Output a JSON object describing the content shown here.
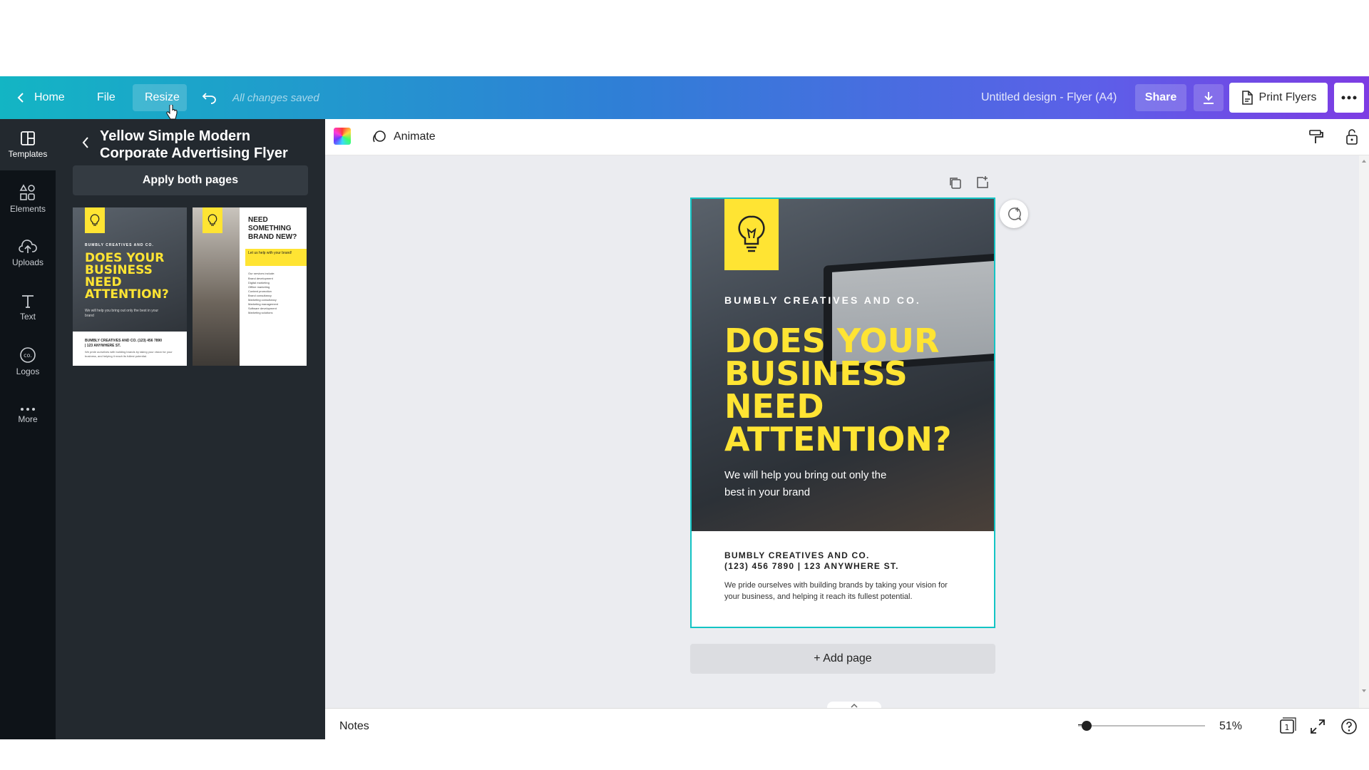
{
  "topbar": {
    "home_label": "Home",
    "file_label": "File",
    "resize_label": "Resize",
    "saved_status": "All changes saved",
    "design_title": "Untitled design - Flyer (A4)",
    "share_label": "Share",
    "print_label": "Print Flyers"
  },
  "rail": {
    "items": [
      {
        "label": "Templates",
        "icon": "templates-icon"
      },
      {
        "label": "Elements",
        "icon": "elements-icon"
      },
      {
        "label": "Uploads",
        "icon": "uploads-icon"
      },
      {
        "label": "Text",
        "icon": "text-icon"
      },
      {
        "label": "Logos",
        "icon": "logos-icon"
      },
      {
        "label": "More",
        "icon": "more-icon"
      }
    ]
  },
  "panel": {
    "title": "Yellow Simple Modern Corporate Advertising Flyer",
    "apply_label": "Apply both pages",
    "thumb1": {
      "company": "BUMBLY CREATIVES AND CO.",
      "headline": "DOES YOUR BUSINESS NEED ATTENTION?",
      "sub": "We will help you bring out only the best in your brand",
      "contact": "BUMBLY CREATIVES AND CO. (123) 456 7890 | 123 ANYWHERE ST.",
      "desc": "We pride ourselves with building brands by taking your vision for your business, and helping it reach its fullest potential."
    },
    "thumb2": {
      "headline": "NEED SOMETHING BRAND NEW?",
      "banner": "Let us help with your brand!",
      "intro": "Our services include:",
      "services": [
        "Brand development",
        "Digital marketing",
        "Offline marketing",
        "Content promotion",
        "Brand consultancy",
        "Marketing consultancy",
        "Marketing management",
        "Software development",
        "Marketing solutions"
      ]
    }
  },
  "toolbar": {
    "animate_label": "Animate"
  },
  "flyer": {
    "company": "BUMBLY CREATIVES AND CO.",
    "headline_lines": [
      "DOES YOUR",
      "BUSINESS",
      "NEED",
      "ATTENTION?"
    ],
    "sub_lines": [
      "We will help you bring out only the",
      "best in your brand"
    ],
    "contact_line1": "BUMBLY CREATIVES AND CO.",
    "contact_line2": "(123) 456 7890 | 123 ANYWHERE ST.",
    "desc_lines": [
      "We pride ourselves with building brands by taking your vision for",
      "your business, and helping it reach its fullest potential."
    ],
    "accent_color": "#ffe433",
    "selection_color": "#13c4c4"
  },
  "add_page_label": "+ Add page",
  "footer": {
    "notes_label": "Notes",
    "zoom_label": "51%",
    "zoom_fraction": 0.07,
    "page_count": "1"
  }
}
